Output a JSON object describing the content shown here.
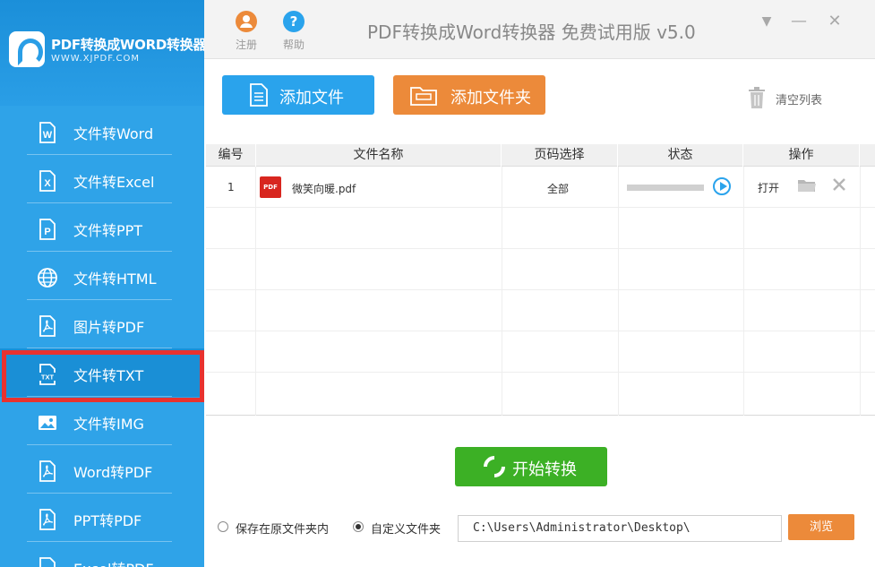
{
  "app": {
    "logo_title": "PDF转换成WORD转换器",
    "logo_url": "WWW.XJPDF.COM",
    "window_title": "PDF转换成Word转换器 免费试用版 v5.0"
  },
  "topbar": {
    "register_label": "注册",
    "help_label": "帮助",
    "help_glyph": "?",
    "minimize_glyph": "—",
    "close_glyph": "✕",
    "menu_glyph": "▼"
  },
  "sidebar": {
    "items": [
      {
        "label": "文件转Word",
        "icon": "word-file-icon",
        "glyph": "W"
      },
      {
        "label": "文件转Excel",
        "icon": "excel-file-icon",
        "glyph": "X"
      },
      {
        "label": "文件转PPT",
        "icon": "ppt-file-icon",
        "glyph": "P"
      },
      {
        "label": "文件转HTML",
        "icon": "globe-icon",
        "glyph": "⊕"
      },
      {
        "label": "图片转PDF",
        "icon": "pdf-file-icon",
        "glyph": "A"
      },
      {
        "label": "文件转TXT",
        "icon": "txt-file-icon",
        "glyph": "TXT"
      },
      {
        "label": "文件转IMG",
        "icon": "image-icon",
        "glyph": "▣"
      },
      {
        "label": "Word转PDF",
        "icon": "pdf-file-icon",
        "glyph": "A"
      },
      {
        "label": "PPT转PDF",
        "icon": "pdf-file-icon",
        "glyph": "A"
      },
      {
        "label": "Excel转PDF",
        "icon": "pdf-file-icon",
        "glyph": "A"
      }
    ],
    "active_index": 5
  },
  "toolbar": {
    "add_file_label": "添加文件",
    "add_folder_label": "添加文件夹",
    "clear_list_label": "清空列表"
  },
  "table": {
    "headers": [
      "编号",
      "文件名称",
      "页码选择",
      "状态",
      "操作"
    ],
    "rows": [
      {
        "index": "1",
        "file_icon_text": "PDF",
        "filename": "微笑向暖.pdf",
        "pages": "全部",
        "progress": 0,
        "open_label": "打开"
      }
    ]
  },
  "actions": {
    "start_label": "开始转换"
  },
  "output": {
    "option_original": "保存在原文件夹内",
    "option_custom": "自定义文件夹",
    "selected": "custom",
    "path": "C:\\Users\\Administrator\\Desktop\\",
    "browse_label": "浏览"
  },
  "colors": {
    "sidebar": "#2fa3e8",
    "active_item": "#1a8fd6",
    "highlight_border": "#e8322f",
    "add_file": "#2aa3ec",
    "add_folder": "#ec8a3a",
    "start": "#3cb025",
    "browse": "#ec8a3a"
  }
}
